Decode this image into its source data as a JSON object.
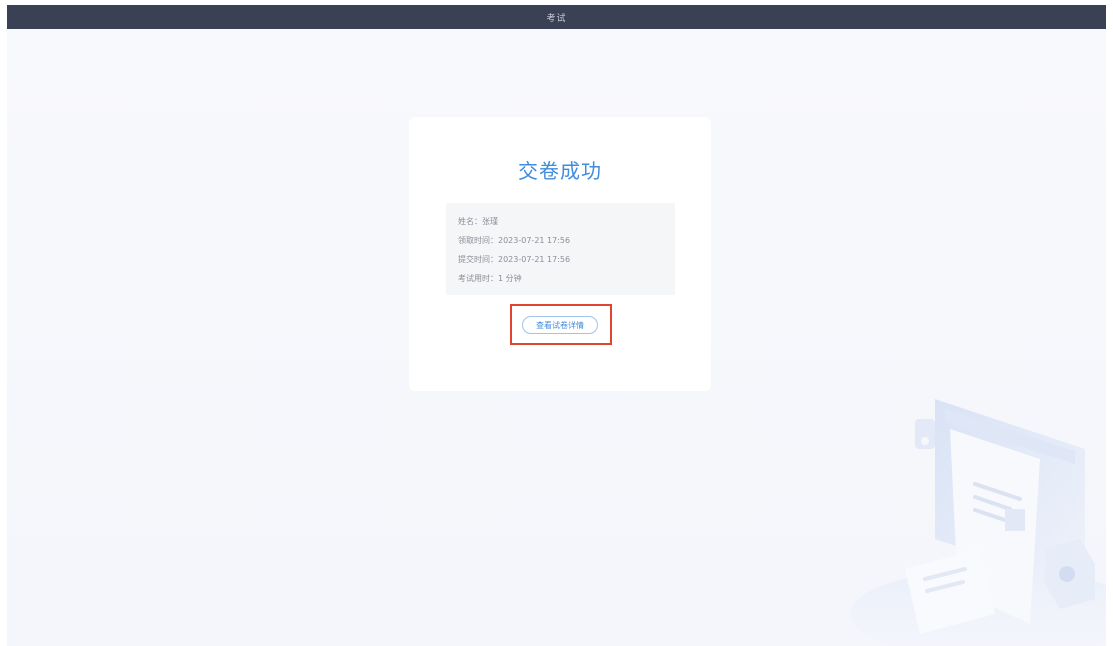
{
  "header": {
    "title": "考试"
  },
  "result": {
    "title": "交卷成功",
    "info": [
      {
        "label": "姓名：",
        "value": "张瑾"
      },
      {
        "label": "领取时间：",
        "value": "2023-07-21 17:56"
      },
      {
        "label": "提交时间：",
        "value": "2023-07-21 17:56"
      },
      {
        "label": "考试用时：",
        "value": "1 分钟"
      }
    ],
    "detail_button": "查看试卷详情"
  },
  "colors": {
    "header_bg": "#3b4154",
    "accent": "#3f8bde",
    "highlight": "#e0432e",
    "page_bg": "#f6f7fb"
  },
  "icons": {
    "illustration": "exam-paper-illustration"
  }
}
